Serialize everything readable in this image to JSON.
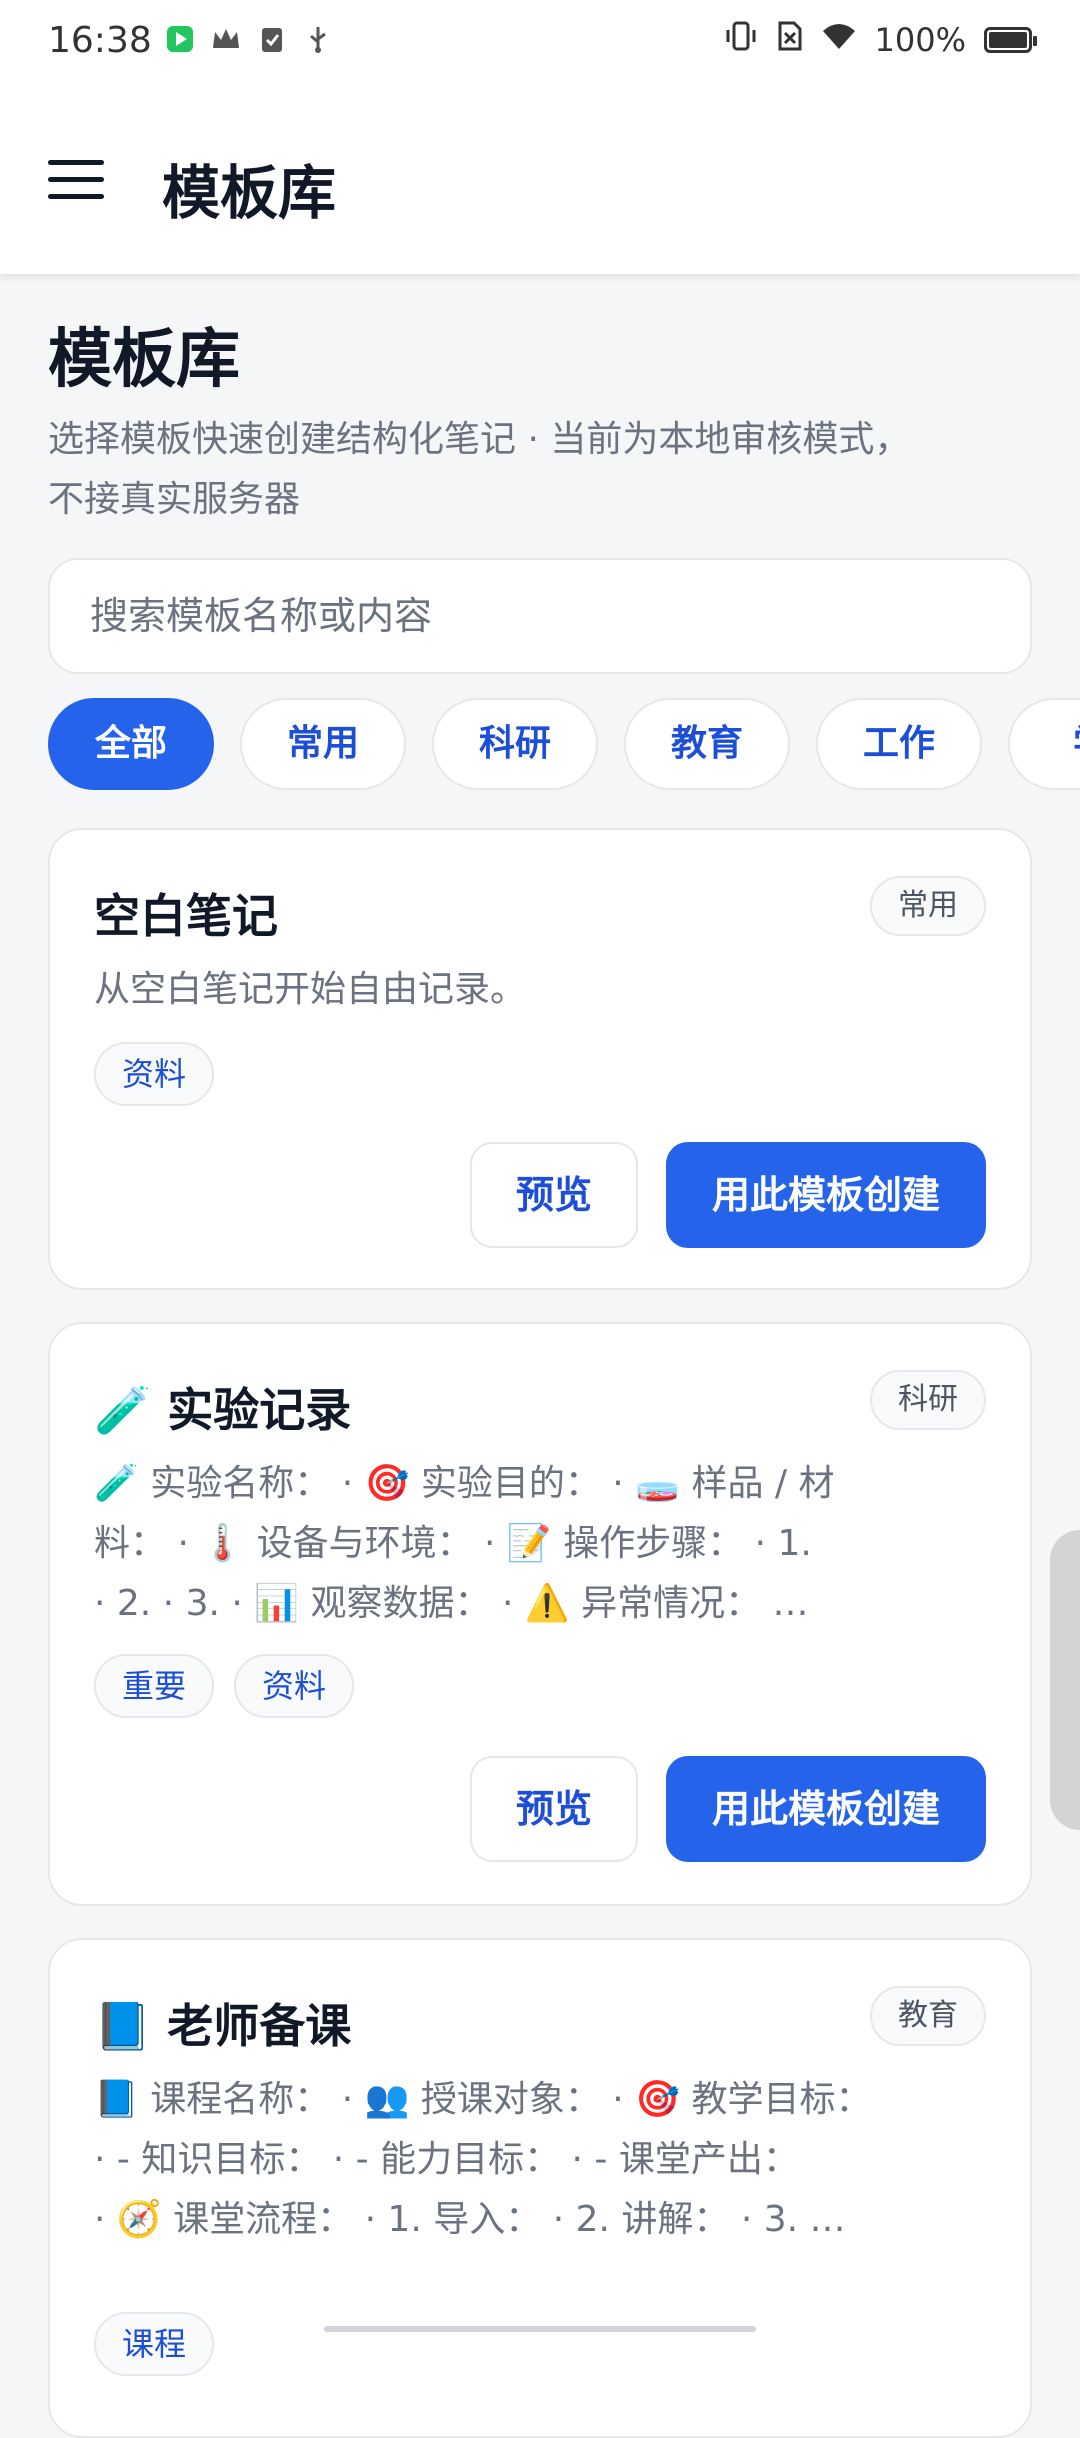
{
  "status_bar": {
    "time": "16:38",
    "battery": "100%",
    "battery_level": 1.0,
    "icons_left": [
      "video-app-icon",
      "crown-icon",
      "clipboard-check-icon",
      "usb-icon"
    ],
    "icons_right": [
      "vibrate-icon",
      "no-sim-icon",
      "wifi-icon",
      "battery-icon"
    ]
  },
  "app_bar": {
    "title": "模板库",
    "menu_icon": "hamburger-icon"
  },
  "page": {
    "title": "模板库",
    "subtitle_line1": "选择模板快速创建结构化笔记 · 当前为本地审核模式，",
    "subtitle_line2": "不接真实服务器"
  },
  "search": {
    "placeholder": "搜索模板名称或内容",
    "value": ""
  },
  "filters": [
    "全部",
    "常用",
    "科研",
    "教育",
    "工作",
    "学"
  ],
  "active_filter": "全部",
  "templates": [
    {
      "title": "空白笔记",
      "category": "常用",
      "desc_line1": "从空白笔记开始自由记录。",
      "desc_line2": "",
      "desc_line3": "",
      "tags": [
        "资料"
      ],
      "preview_label": "预览",
      "create_label": "用此模板创建"
    },
    {
      "title": "🧪 实验记录",
      "category": "科研",
      "desc_line1": "🧪 实验名称： · 🎯 实验目的： · 🧫 样品 / 材",
      "desc_line2": "料： · 🌡️ 设备与环境： · 📝 操作步骤： · 1.",
      "desc_line3": " · 2.  · 3.  · 📊 观察数据： · ⚠️ 异常情况： …",
      "tags": [
        "重要",
        "资料"
      ],
      "preview_label": "预览",
      "create_label": "用此模板创建"
    },
    {
      "title": "📘 老师备课",
      "category": "教育",
      "desc_line1": "📘 课程名称： · 👥 授课对象： · 🎯 教学目标：",
      "desc_line2": " · - 知识目标： · - 能力目标： · - 课堂产出：",
      "desc_line3": " · 🧭 课堂流程： · 1. 导入： · 2. 讲解： · 3. …",
      "tags": [
        "课程"
      ],
      "preview_label": "预览",
      "create_label": "用此模板创建"
    }
  ],
  "colors": {
    "primary": "#2563eb",
    "background": "#f5f6f8",
    "card": "#ffffff",
    "text": "#111827",
    "muted": "#6b7280"
  }
}
